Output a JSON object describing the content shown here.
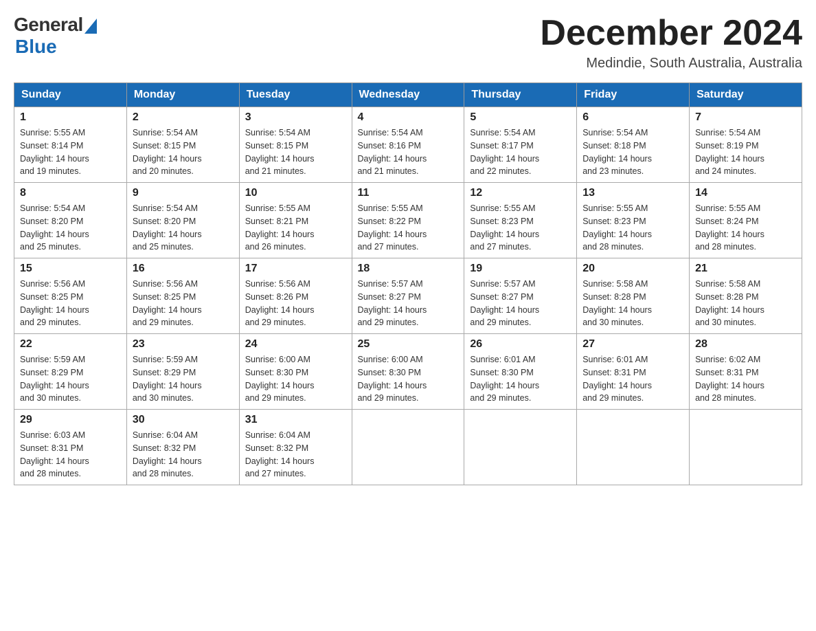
{
  "logo": {
    "general": "General",
    "blue": "Blue"
  },
  "header": {
    "title": "December 2024",
    "location": "Medindie, South Australia, Australia"
  },
  "days_of_week": [
    "Sunday",
    "Monday",
    "Tuesday",
    "Wednesday",
    "Thursday",
    "Friday",
    "Saturday"
  ],
  "weeks": [
    [
      {
        "num": "1",
        "info": "Sunrise: 5:55 AM\nSunset: 8:14 PM\nDaylight: 14 hours\nand 19 minutes."
      },
      {
        "num": "2",
        "info": "Sunrise: 5:54 AM\nSunset: 8:15 PM\nDaylight: 14 hours\nand 20 minutes."
      },
      {
        "num": "3",
        "info": "Sunrise: 5:54 AM\nSunset: 8:15 PM\nDaylight: 14 hours\nand 21 minutes."
      },
      {
        "num": "4",
        "info": "Sunrise: 5:54 AM\nSunset: 8:16 PM\nDaylight: 14 hours\nand 21 minutes."
      },
      {
        "num": "5",
        "info": "Sunrise: 5:54 AM\nSunset: 8:17 PM\nDaylight: 14 hours\nand 22 minutes."
      },
      {
        "num": "6",
        "info": "Sunrise: 5:54 AM\nSunset: 8:18 PM\nDaylight: 14 hours\nand 23 minutes."
      },
      {
        "num": "7",
        "info": "Sunrise: 5:54 AM\nSunset: 8:19 PM\nDaylight: 14 hours\nand 24 minutes."
      }
    ],
    [
      {
        "num": "8",
        "info": "Sunrise: 5:54 AM\nSunset: 8:20 PM\nDaylight: 14 hours\nand 25 minutes."
      },
      {
        "num": "9",
        "info": "Sunrise: 5:54 AM\nSunset: 8:20 PM\nDaylight: 14 hours\nand 25 minutes."
      },
      {
        "num": "10",
        "info": "Sunrise: 5:55 AM\nSunset: 8:21 PM\nDaylight: 14 hours\nand 26 minutes."
      },
      {
        "num": "11",
        "info": "Sunrise: 5:55 AM\nSunset: 8:22 PM\nDaylight: 14 hours\nand 27 minutes."
      },
      {
        "num": "12",
        "info": "Sunrise: 5:55 AM\nSunset: 8:23 PM\nDaylight: 14 hours\nand 27 minutes."
      },
      {
        "num": "13",
        "info": "Sunrise: 5:55 AM\nSunset: 8:23 PM\nDaylight: 14 hours\nand 28 minutes."
      },
      {
        "num": "14",
        "info": "Sunrise: 5:55 AM\nSunset: 8:24 PM\nDaylight: 14 hours\nand 28 minutes."
      }
    ],
    [
      {
        "num": "15",
        "info": "Sunrise: 5:56 AM\nSunset: 8:25 PM\nDaylight: 14 hours\nand 29 minutes."
      },
      {
        "num": "16",
        "info": "Sunrise: 5:56 AM\nSunset: 8:25 PM\nDaylight: 14 hours\nand 29 minutes."
      },
      {
        "num": "17",
        "info": "Sunrise: 5:56 AM\nSunset: 8:26 PM\nDaylight: 14 hours\nand 29 minutes."
      },
      {
        "num": "18",
        "info": "Sunrise: 5:57 AM\nSunset: 8:27 PM\nDaylight: 14 hours\nand 29 minutes."
      },
      {
        "num": "19",
        "info": "Sunrise: 5:57 AM\nSunset: 8:27 PM\nDaylight: 14 hours\nand 29 minutes."
      },
      {
        "num": "20",
        "info": "Sunrise: 5:58 AM\nSunset: 8:28 PM\nDaylight: 14 hours\nand 30 minutes."
      },
      {
        "num": "21",
        "info": "Sunrise: 5:58 AM\nSunset: 8:28 PM\nDaylight: 14 hours\nand 30 minutes."
      }
    ],
    [
      {
        "num": "22",
        "info": "Sunrise: 5:59 AM\nSunset: 8:29 PM\nDaylight: 14 hours\nand 30 minutes."
      },
      {
        "num": "23",
        "info": "Sunrise: 5:59 AM\nSunset: 8:29 PM\nDaylight: 14 hours\nand 30 minutes."
      },
      {
        "num": "24",
        "info": "Sunrise: 6:00 AM\nSunset: 8:30 PM\nDaylight: 14 hours\nand 29 minutes."
      },
      {
        "num": "25",
        "info": "Sunrise: 6:00 AM\nSunset: 8:30 PM\nDaylight: 14 hours\nand 29 minutes."
      },
      {
        "num": "26",
        "info": "Sunrise: 6:01 AM\nSunset: 8:30 PM\nDaylight: 14 hours\nand 29 minutes."
      },
      {
        "num": "27",
        "info": "Sunrise: 6:01 AM\nSunset: 8:31 PM\nDaylight: 14 hours\nand 29 minutes."
      },
      {
        "num": "28",
        "info": "Sunrise: 6:02 AM\nSunset: 8:31 PM\nDaylight: 14 hours\nand 28 minutes."
      }
    ],
    [
      {
        "num": "29",
        "info": "Sunrise: 6:03 AM\nSunset: 8:31 PM\nDaylight: 14 hours\nand 28 minutes."
      },
      {
        "num": "30",
        "info": "Sunrise: 6:04 AM\nSunset: 8:32 PM\nDaylight: 14 hours\nand 28 minutes."
      },
      {
        "num": "31",
        "info": "Sunrise: 6:04 AM\nSunset: 8:32 PM\nDaylight: 14 hours\nand 27 minutes."
      },
      null,
      null,
      null,
      null
    ]
  ]
}
